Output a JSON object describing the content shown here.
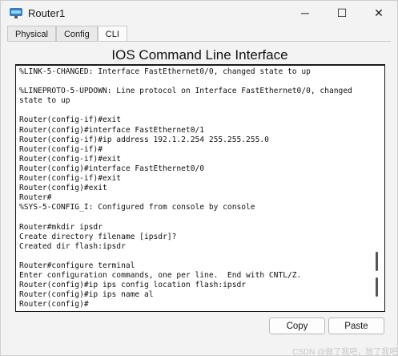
{
  "window": {
    "title": "Router1",
    "icon": "router-app-icon",
    "controls": {
      "minimize": "─",
      "maximize": "☐",
      "close": "✕"
    }
  },
  "tabs": [
    {
      "label": "Physical",
      "active": false
    },
    {
      "label": "Config",
      "active": false
    },
    {
      "label": "CLI",
      "active": true
    }
  ],
  "cli": {
    "heading": "IOS Command Line Interface",
    "lines": [
      "%LINK-5-CHANGED: Interface FastEthernet0/0, changed state to up",
      "",
      "%LINEPROTO-5-UPDOWN: Line protocol on Interface FastEthernet0/0, changed",
      "state to up",
      "",
      "Router(config-if)#exit",
      "Router(config)#interface FastEthernet0/1",
      "Router(config-if)#ip address 192.1.2.254 255.255.255.0",
      "Router(config-if)#",
      "Router(config-if)#exit",
      "Router(config)#interface FastEthernet0/0",
      "Router(config-if)#exit",
      "Router(config)#exit",
      "Router#",
      "%SYS-5-CONFIG_I: Configured from console by console",
      "",
      "Router#mkdir ipsdr",
      "Create directory filename [ipsdr]?",
      "Created dir flash:ipsdr",
      "",
      "Router#configure terminal",
      "Enter configuration commands, one per line.  End with CNTL/Z.",
      "Router(config)#ip ips config location flash:ipsdr",
      "Router(config)#ip ips name al",
      "Router(config)#"
    ]
  },
  "buttons": {
    "copy": "Copy",
    "paste": "Paste"
  },
  "watermark": "CSDN @做了我吧，放了我吧"
}
